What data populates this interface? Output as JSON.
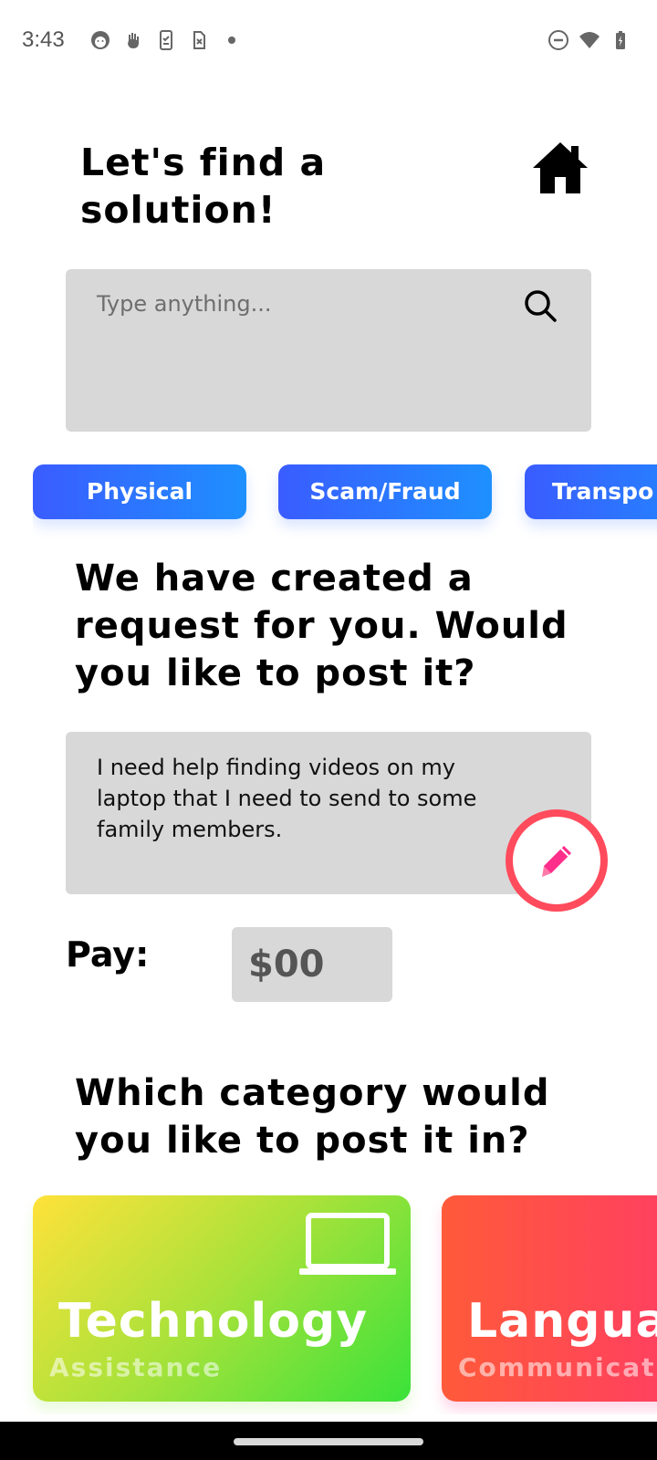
{
  "status_bar": {
    "time": "3:43",
    "left_icons": [
      "face-icon",
      "hand-icon",
      "clipboard-phone-icon",
      "sim-error-icon",
      "dot-icon"
    ],
    "right_icons": [
      "do-not-disturb-icon",
      "wifi-icon",
      "battery-icon"
    ]
  },
  "header": {
    "title": "Let's find a solution!",
    "home_icon": "home-icon"
  },
  "search": {
    "placeholder": "Type anything...",
    "icon": "search-icon"
  },
  "chips": [
    {
      "label": "Physical"
    },
    {
      "label": "Scam/Fraud"
    },
    {
      "label": "Transpo"
    }
  ],
  "request": {
    "heading": "We have created a request for you. Would you like to post it?",
    "text": "I need help finding videos on my laptop that I need to send to some family members.",
    "edit_icon": "pencil-icon"
  },
  "pay": {
    "label": "Pay:",
    "value": "$00"
  },
  "category_section": {
    "heading": "Which category would you like to post it in?",
    "cards": [
      {
        "title": "Technology",
        "subtitle": "Assistance",
        "icon": "laptop-icon"
      },
      {
        "title": "Languag",
        "subtitle": "Communicatio"
      }
    ]
  },
  "colors": {
    "chip_gradient_start": "#3a5cff",
    "chip_gradient_end": "#1e90ff",
    "edit_ring": "#ff4b5c",
    "edit_pencil": "#ff2e8a",
    "field_bg": "#d8d8d8"
  }
}
